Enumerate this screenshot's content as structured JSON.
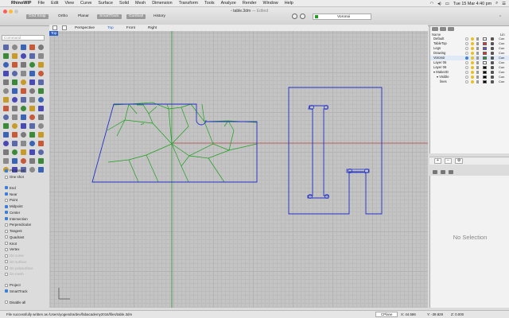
{
  "menubar": {
    "app_name": "RhinoWIP",
    "items": [
      "File",
      "Edit",
      "View",
      "Curve",
      "Surface",
      "Solid",
      "Mesh",
      "Dimension",
      "Transform",
      "Tools",
      "Analyze",
      "Render",
      "Window",
      "Help"
    ],
    "clock": "Tue 15 Mar  4:40 pm"
  },
  "titlebar": {
    "doc_name": "table.3dm",
    "doc_status": "— Edited",
    "modes": [
      {
        "label": "Grid Snap",
        "on": true
      },
      {
        "label": "Ortho",
        "on": false
      },
      {
        "label": "Planar",
        "on": false
      },
      {
        "label": "SmartTrack",
        "on": true
      },
      {
        "label": "Gumball",
        "on": true
      },
      {
        "label": "History",
        "on": false
      }
    ],
    "current_layer": "Voronoi",
    "current_layer_color": "#1ea01e"
  },
  "command": {
    "placeholder": "Command"
  },
  "viewport": {
    "tabs": [
      "Perspective",
      "Top",
      "Front",
      "Right"
    ],
    "active_tab": "Top",
    "label": "Top",
    "colors": {
      "grid_bg": "#c4c4c4",
      "x_axis": "#b04040",
      "y_axis": "#2f9a2f",
      "curves": "#2030c8",
      "voronoi": "#1ea01e"
    }
  },
  "osnap": [
    {
      "label": "Persistent",
      "checked": true,
      "disabled": false
    },
    {
      "label": "One shot",
      "checked": false,
      "disabled": false
    },
    {
      "label": "End",
      "checked": true,
      "disabled": false
    },
    {
      "label": "Near",
      "checked": true,
      "disabled": false
    },
    {
      "label": "Point",
      "checked": false,
      "disabled": false
    },
    {
      "label": "Midpoint",
      "checked": true,
      "disabled": false
    },
    {
      "label": "Center",
      "checked": true,
      "disabled": false
    },
    {
      "label": "Intersection",
      "checked": true,
      "disabled": false
    },
    {
      "label": "Perpendicular",
      "checked": false,
      "disabled": false
    },
    {
      "label": "Tangent",
      "checked": false,
      "disabled": false
    },
    {
      "label": "Quadrant",
      "checked": false,
      "disabled": false
    },
    {
      "label": "Knot",
      "checked": false,
      "disabled": false
    },
    {
      "label": "Vertex",
      "checked": false,
      "disabled": false
    },
    {
      "label": "On curve",
      "checked": false,
      "disabled": true
    },
    {
      "label": "On surface",
      "checked": false,
      "disabled": true
    },
    {
      "label": "On polysurface",
      "checked": false,
      "disabled": true
    },
    {
      "label": "On mesh",
      "checked": false,
      "disabled": true
    },
    {
      "label": "Project",
      "checked": false,
      "disabled": false
    },
    {
      "label": "SmartTrack",
      "checked": true,
      "disabled": false
    }
  ],
  "osnap_disable_all": "Disable all",
  "layers": {
    "header_name": "Name",
    "header_material": "Lin",
    "rows": [
      {
        "name": "Default",
        "indent": 0,
        "current": false,
        "color": "#ffffff",
        "mat": "Con"
      },
      {
        "name": "TableTop",
        "indent": 0,
        "current": false,
        "color": "#e03030",
        "mat": "Con"
      },
      {
        "name": "Legs",
        "indent": 0,
        "current": false,
        "color": "#6050d0",
        "mat": "Con"
      },
      {
        "name": "Drawing",
        "indent": 0,
        "current": false,
        "color": "#e03030",
        "mat": "Con"
      },
      {
        "name": "Voronoi",
        "indent": 0,
        "current": true,
        "color": "#1ea01e",
        "mat": "Con"
      },
      {
        "name": "Layer 05",
        "indent": 0,
        "current": false,
        "color": "#ffffff",
        "mat": "Con"
      },
      {
        "name": "Layer 06",
        "indent": 0,
        "current": false,
        "color": "#000000",
        "mat": "Con"
      },
      {
        "name": "Make2D",
        "indent": 0,
        "current": false,
        "color": "#000000",
        "mat": "Con",
        "expander": "▾"
      },
      {
        "name": "Visible",
        "indent": 1,
        "current": false,
        "color": "#000000",
        "mat": "Con",
        "expander": "▾"
      },
      {
        "name": "lines",
        "indent": 2,
        "current": false,
        "color": "#000000",
        "mat": "Con"
      }
    ],
    "buttons": [
      "+",
      "−",
      "⚙"
    ]
  },
  "properties": {
    "empty_text": "No Selection"
  },
  "status": {
    "message": "File successfully written as /Users/yogendra/dev/fabacademy2016/files/table.3dm",
    "cplane": "CPlane",
    "x": "X: 44.586",
    "y": "Y: -39.829",
    "z": "Z: 0.000"
  }
}
